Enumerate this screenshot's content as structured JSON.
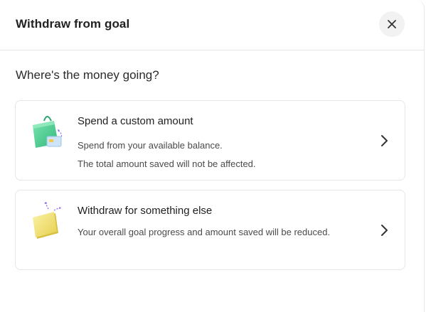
{
  "modal": {
    "title": "Withdraw from goal",
    "close_icon": "close-icon"
  },
  "question": "Where's the money going?",
  "options": [
    {
      "title": "Spend a custom amount",
      "desc_line1": "Spend from your available balance.",
      "desc_line2": "The total amount saved will not be affected.",
      "icon": "shopping-bag-card-icon"
    },
    {
      "title": "Withdraw for something else",
      "desc": "Your overall goal progress and amount saved will be reduced.",
      "icon": "wallet-arrows-icon"
    }
  ],
  "colors": {
    "accent_green": "#3ecf8e",
    "accent_yellow": "#f2e27a",
    "accent_purple": "#8a5cf6",
    "border": "#e6e6e6"
  }
}
